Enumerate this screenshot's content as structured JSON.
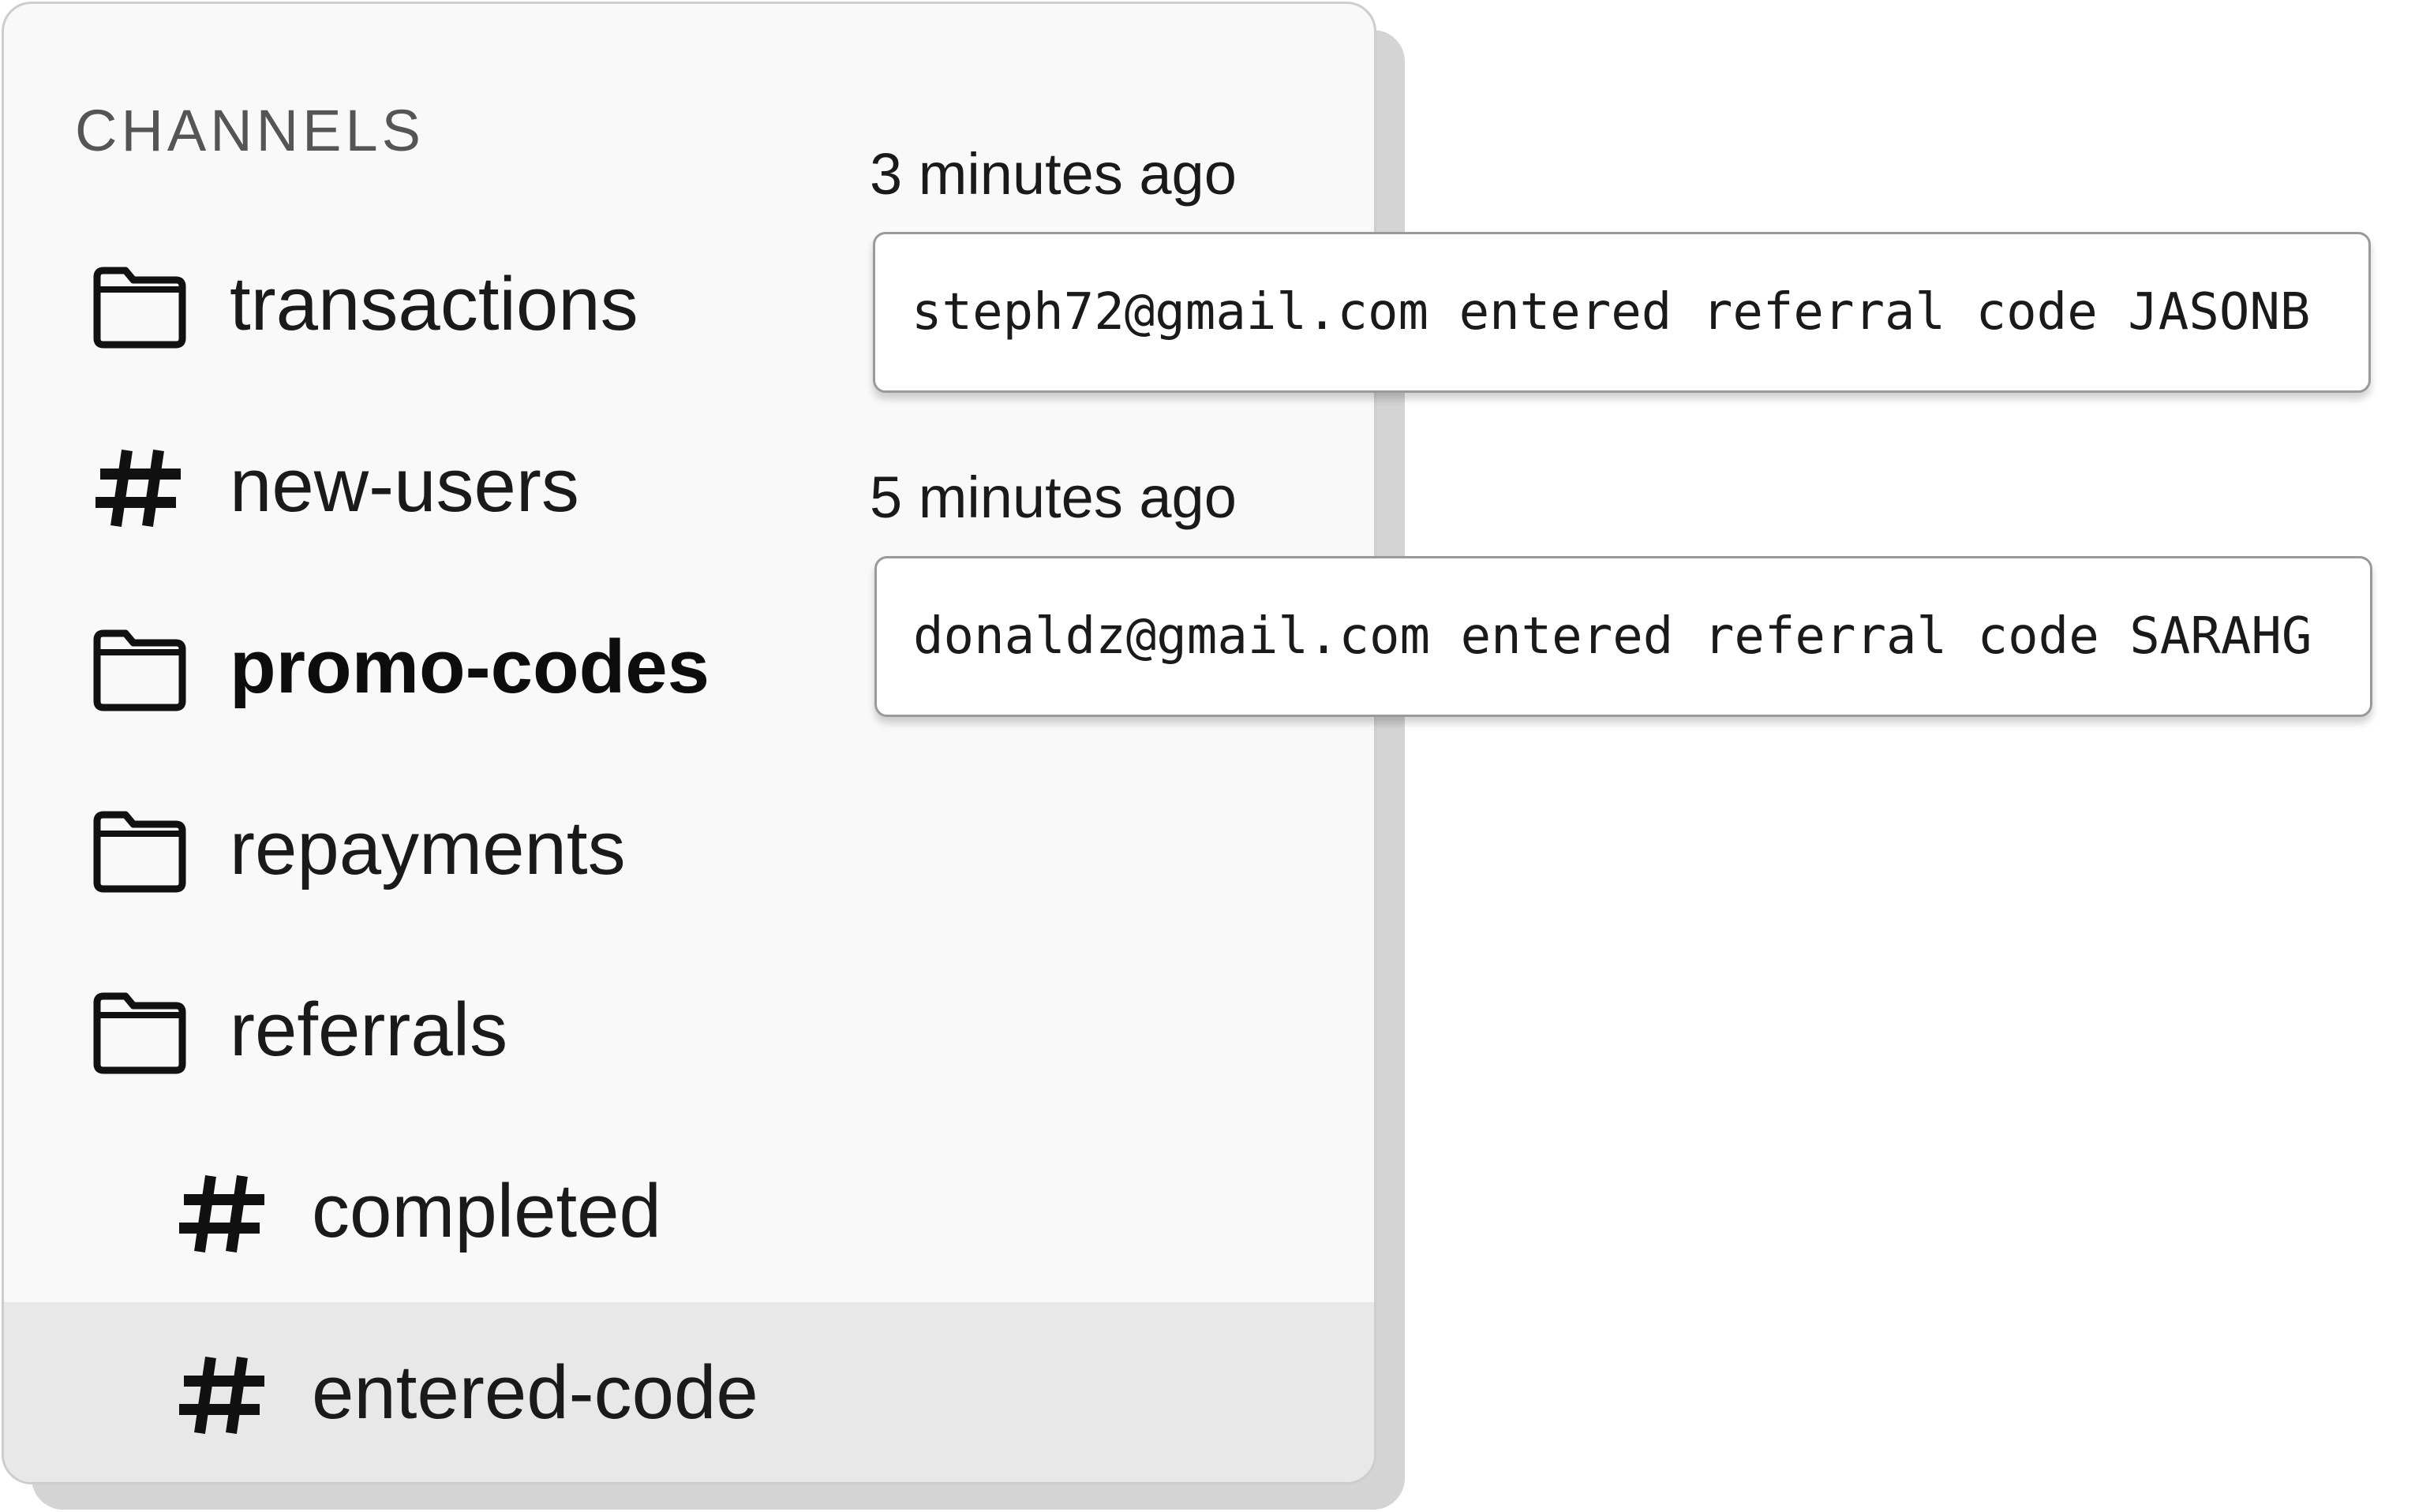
{
  "sidebar": {
    "heading": "CHANNELS",
    "channels": [
      {
        "label": "transactions",
        "icon": "folder-icon"
      },
      {
        "label": "new-users",
        "icon": "hash-icon"
      },
      {
        "label": "promo-codes",
        "icon": "folder-icon",
        "bold": true
      },
      {
        "label": "repayments",
        "icon": "folder-icon"
      },
      {
        "label": "referrals",
        "icon": "folder-icon"
      },
      {
        "label": "completed",
        "icon": "hash-icon",
        "nested": true
      },
      {
        "label": "entered-code",
        "icon": "hash-icon",
        "nested": true,
        "selected": true
      }
    ]
  },
  "messages": [
    {
      "time": "3 minutes ago",
      "text": "steph72@gmail.com entered referral code JASONB"
    },
    {
      "time": "5 minutes ago",
      "text": "donaldz@gmail.com entered referral code SARAHG"
    }
  ],
  "colors": {
    "panel_bg": "#f9f9f9",
    "selected_bg": "#e8e8e8",
    "shadow": "#d4d4d4",
    "text": "#1a1a1a"
  }
}
